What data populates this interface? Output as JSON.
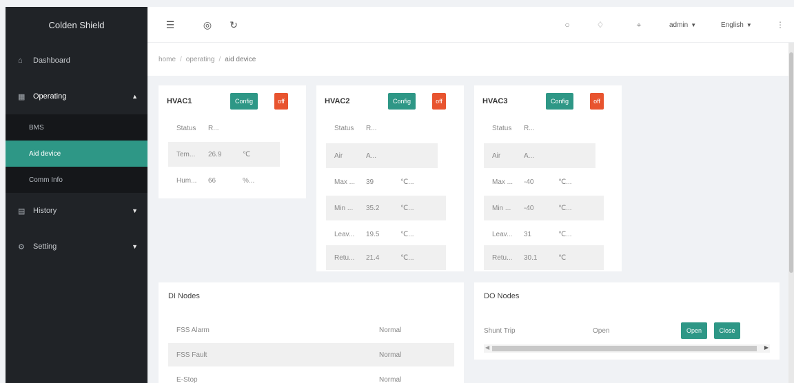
{
  "app": {
    "brand": "Colden Shield"
  },
  "sidebar": {
    "dashboard": {
      "label": "Dashboard"
    },
    "operating": {
      "label": "Operating",
      "children": [
        "BMS",
        "Aid device",
        "Comm Info"
      ]
    },
    "history": {
      "label": "History"
    },
    "setting": {
      "label": "Setting"
    }
  },
  "topbar": {
    "user": "admin",
    "language": "English"
  },
  "breadcrumb": [
    "home",
    "operating",
    "aid device"
  ],
  "hvac": [
    {
      "name": "HVAC1",
      "config_label": "Config",
      "off_label": "off",
      "rows": [
        {
          "k": "Status",
          "v": "R...",
          "u": ""
        },
        {
          "k": "Tem...",
          "v": "26.9",
          "u": "℃"
        },
        {
          "k": "Hum...",
          "v": "66",
          "u": "%..."
        }
      ]
    },
    {
      "name": "HVAC2",
      "config_label": "Config",
      "off_label": "off",
      "rows": [
        {
          "k": "Status",
          "v": "R...",
          "u": ""
        },
        {
          "k": "Air",
          "v": "A...",
          "u": ""
        },
        {
          "k": "Max ...",
          "v": "39",
          "u": "℃..."
        },
        {
          "k": "Min ...",
          "v": "35.2",
          "u": "℃..."
        },
        {
          "k": "Leav...",
          "v": "19.5",
          "u": "℃..."
        },
        {
          "k": "Retu...",
          "v": "21.4",
          "u": "℃..."
        }
      ]
    },
    {
      "name": "HVAC3",
      "config_label": "Config",
      "off_label": "off",
      "rows": [
        {
          "k": "Status",
          "v": "R...",
          "u": ""
        },
        {
          "k": "Air",
          "v": "A...",
          "u": ""
        },
        {
          "k": "Max ...",
          "v": "-40",
          "u": "℃..."
        },
        {
          "k": "Min ...",
          "v": "-40",
          "u": "℃..."
        },
        {
          "k": "Leav...",
          "v": "31",
          "u": "℃..."
        },
        {
          "k": "Retu...",
          "v": "30.1",
          "u": "℃"
        }
      ]
    }
  ],
  "di_nodes": {
    "title": "DI Nodes",
    "rows": [
      {
        "name": "FSS Alarm",
        "status": "Normal"
      },
      {
        "name": "FSS Fault",
        "status": "Normal"
      },
      {
        "name": "E-Stop",
        "status": "Normal"
      }
    ]
  },
  "do_nodes": {
    "title": "DO Nodes",
    "rows": [
      {
        "name": "Shunt Trip",
        "status": "Open",
        "open_label": "Open",
        "close_label": "Close"
      }
    ]
  },
  "colors": {
    "accent": "#2e9786",
    "danger": "#e8542f",
    "sidebar_bg": "#202327"
  },
  "icons": [
    "menu-fold-icon",
    "globe-icon",
    "refresh-icon",
    "chat-icon",
    "tag-icon",
    "fullscreen-icon",
    "more-icon",
    "home-icon",
    "operating-icon",
    "history-icon",
    "setting-icon"
  ]
}
